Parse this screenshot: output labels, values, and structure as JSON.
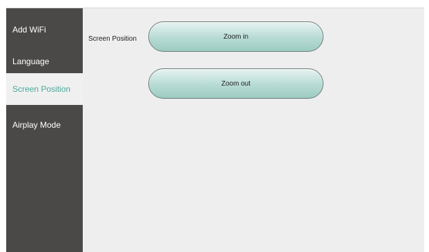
{
  "sidebar": {
    "items": [
      {
        "label": "Add WiFi"
      },
      {
        "label": "Language"
      },
      {
        "label": "Screen Position"
      },
      {
        "label": "Airplay Mode"
      }
    ],
    "active_index": 2
  },
  "main": {
    "section_label": "Screen Position",
    "zoom_in_label": "Zoom in",
    "zoom_out_label": "Zoom out"
  },
  "colors": {
    "sidebar_bg": "#4b4948",
    "active_text": "#4aa89a",
    "main_bg": "#eeeeee",
    "button_fill": "#b7dbd4"
  }
}
